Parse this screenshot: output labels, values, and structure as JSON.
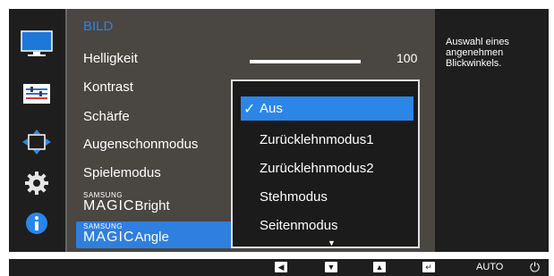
{
  "menu": {
    "title": "BILD",
    "items": [
      "Helligkeit",
      "Kontrast",
      "Schärfe",
      "Augenschonmodus",
      "Spielemodus"
    ],
    "magic_bright": {
      "brand_small": "SAMSUNG",
      "brand_big": "MAGIC",
      "word": "Bright"
    },
    "magic_angle": {
      "brand_small": "SAMSUNG",
      "brand_big": "MAGIC",
      "word": "Angle"
    },
    "brightness_value": "100",
    "brightness_level": 1.0
  },
  "dropdown": {
    "selected": "Aus",
    "check": "✓",
    "options": [
      "Zurücklehnmodus1",
      "Zurücklehnmodus2",
      "Stehmodus",
      "Seitenmodus"
    ],
    "more_arrow": "▼"
  },
  "help": {
    "text": "Auswahl eines angenehmen Blickwinkels."
  },
  "bottom_bar": {
    "keys": [
      "◀",
      "▼",
      "▲",
      "↵"
    ],
    "auto_label": "AUTO",
    "power_symbol": "⏻"
  },
  "icons": [
    "monitor-icon",
    "settings-sliders-icon",
    "position-arrows-icon",
    "gear-icon",
    "info-icon"
  ],
  "colors": {
    "accent": "#2f7fe0",
    "panel": "#1e1e1e",
    "menu": "#4a4642",
    "title": "#2d82e6"
  }
}
